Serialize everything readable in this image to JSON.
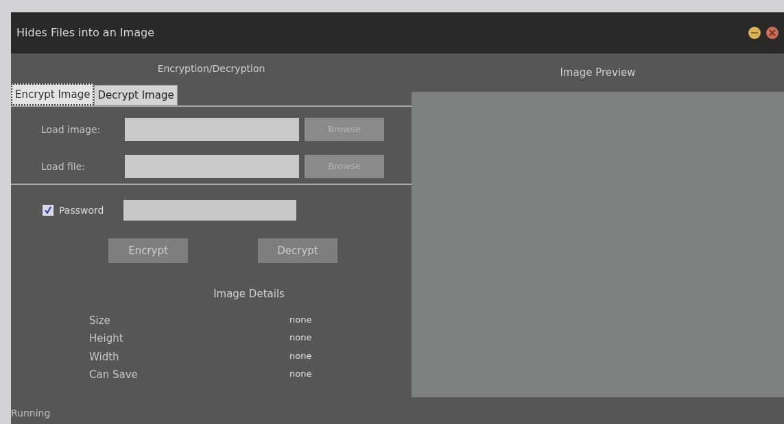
{
  "window": {
    "title": "Hides Files into an Image"
  },
  "left_panel": {
    "title": "Encryption/Decryption"
  },
  "tabs": [
    {
      "label": "Encrypt Image",
      "selected": true
    },
    {
      "label": "Decrypt Image",
      "selected": false
    }
  ],
  "file_rows": [
    {
      "label": "Load image:",
      "button": "Browse"
    },
    {
      "label": "Load file:",
      "button": "Browse"
    }
  ],
  "password": {
    "label": "Password",
    "checked": true
  },
  "actions": [
    {
      "label": "Encrypt",
      "disabled": true
    },
    {
      "label": "Decrypt",
      "disabled": true
    }
  ],
  "details": {
    "title": "Image Details",
    "rows": [
      {
        "name": "Size",
        "value": "none"
      },
      {
        "name": "Height",
        "value": "none"
      },
      {
        "name": "Width",
        "value": "none"
      },
      {
        "name": "Can Save",
        "value": "none"
      }
    ]
  },
  "preview": {
    "title": "Image Preview"
  },
  "status_bar": "Running"
}
